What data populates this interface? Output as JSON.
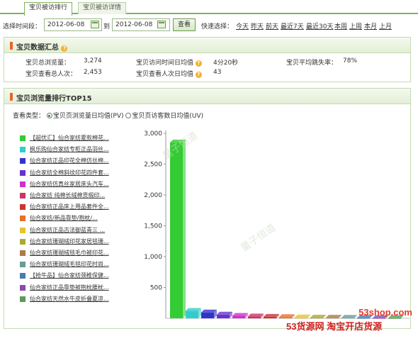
{
  "tabs": [
    {
      "label": "宝贝被访排行",
      "active": true
    },
    {
      "label": "宝贝被访详情",
      "active": false
    }
  ],
  "date_filter": {
    "label": "选择时间段：",
    "start": "2012-06-08",
    "to": "到",
    "end": "2012-06-08",
    "view_button": "查看",
    "quick_label": "快速选择：",
    "quick_links": [
      "今天",
      "昨天",
      "前天",
      "最近7天",
      "最近30天",
      "本周",
      "上周",
      "本月",
      "上月"
    ]
  },
  "summary": {
    "title": "宝贝数据汇总",
    "fields": [
      {
        "label": "宝贝总浏览量：",
        "value": "3,274"
      },
      {
        "label": "宝贝访问时间日均值",
        "value": "4分20秒"
      },
      {
        "label": "宝贝平均跳失率：",
        "value": "78%"
      },
      {
        "label": "宝贝查看总人次：",
        "value": "2,453"
      },
      {
        "label": "宝贝查看人次日均值",
        "value": "43"
      }
    ]
  },
  "ranking": {
    "title": "宝贝浏览量排行TOP15",
    "view_type_label": "查看类型：",
    "options": [
      {
        "label": "宝贝页浏览量日均值(PV)",
        "selected": true
      },
      {
        "label": "宝贝页访客数日均值(UV)",
        "selected": false
      }
    ],
    "items": [
      {
        "label": "【超优汇】仙合家纺夏款棉花...",
        "color": "#33cc33"
      },
      {
        "label": "枫乐购仙合家纺专柜正品羽丝...",
        "color": "#33cccc"
      },
      {
        "label": "仙合家纺正品印花全棉仿丝棉...",
        "color": "#3333cc"
      },
      {
        "label": "仙合家纺全棉斜纹印花四件套...",
        "color": "#6633cc"
      },
      {
        "label": "仙合家纺仿真丝家居床头汽车...",
        "color": "#cc33cc"
      },
      {
        "label": "仙合家纺 纯棉长绒棉贡缎印...",
        "color": "#cc3366"
      },
      {
        "label": "仙合家纺正品床上用品套件全...",
        "color": "#cc3333"
      },
      {
        "label": "仙合家纺/新品靠垫/抱枕/...",
        "color": "#e8702a"
      },
      {
        "label": "仙合家纺正品古法御蓝青三 ...",
        "color": "#e8c22a"
      },
      {
        "label": "仙合家纺珊瑚绒印花家居毯珊...",
        "color": "#aaaa33"
      },
      {
        "label": "仙合家纺珊瑚绒毯毛巾被印花...",
        "color": "#aa7a4a"
      },
      {
        "label": "仙合家纺珊瑚绒毛毯印花时尚...",
        "color": "#6a9a9a"
      },
      {
        "label": "【抢牛品】仙合家纺颈椎保健...",
        "color": "#4a7ab0"
      },
      {
        "label": "仙合家纺正品靠垫被抱枕腰枕...",
        "color": "#8a4ab0"
      },
      {
        "label": "仙合家纺天然水牛皮折叠夏凉...",
        "color": "#5a9a5a"
      }
    ]
  },
  "chart_data": {
    "type": "bar",
    "categories": [
      "【超优汇】仙合家纺夏款棉花...",
      "枫乐购仙合家纺专柜正品羽丝...",
      "仙合家纺正品印花全棉仿丝棉...",
      "仙合家纺全棉斜纹印花四件套...",
      "仙合家纺仿真丝家居床头汽车...",
      "仙合家纺 纯棉长绒棉贡缎印...",
      "仙合家纺正品床上用品套件全...",
      "仙合家纺/新品靠垫/抱枕/...",
      "仙合家纺正品古法御蓝青三 ...",
      "仙合家纺珊瑚绒印花家居毯珊...",
      "仙合家纺珊瑚绒毯毛巾被印花...",
      "仙合家纺珊瑚绒毛毯印花时尚...",
      "【抢牛品】仙合家纺颈椎保健...",
      "仙合家纺正品靠垫被抱枕腰枕...",
      "仙合家纺天然水牛皮折叠夏凉..."
    ],
    "values": [
      2850,
      120,
      95,
      60,
      40,
      30,
      25,
      20,
      15,
      12,
      10,
      8,
      6,
      5,
      4
    ],
    "yticks": [
      500,
      1000,
      1500,
      2000,
      2500,
      3000
    ],
    "ytick_labels": [
      "500",
      "1,000",
      "1,500",
      "2,000",
      "2,500",
      "3,000"
    ],
    "ylim": [
      0,
      3000
    ],
    "grid": false,
    "colors": [
      "#33cc33",
      "#33cccc",
      "#3333cc",
      "#6633cc",
      "#cc33cc",
      "#cc3366",
      "#cc3333",
      "#e8702a",
      "#e8c22a",
      "#aaaa33",
      "#aa7a4a",
      "#6a9a9a",
      "#4a7ab0",
      "#8a4ab0",
      "#5a9a5a"
    ]
  },
  "watermark": {
    "site": "53shop.com",
    "brand_line": "53货源网 淘宝开店货源"
  }
}
